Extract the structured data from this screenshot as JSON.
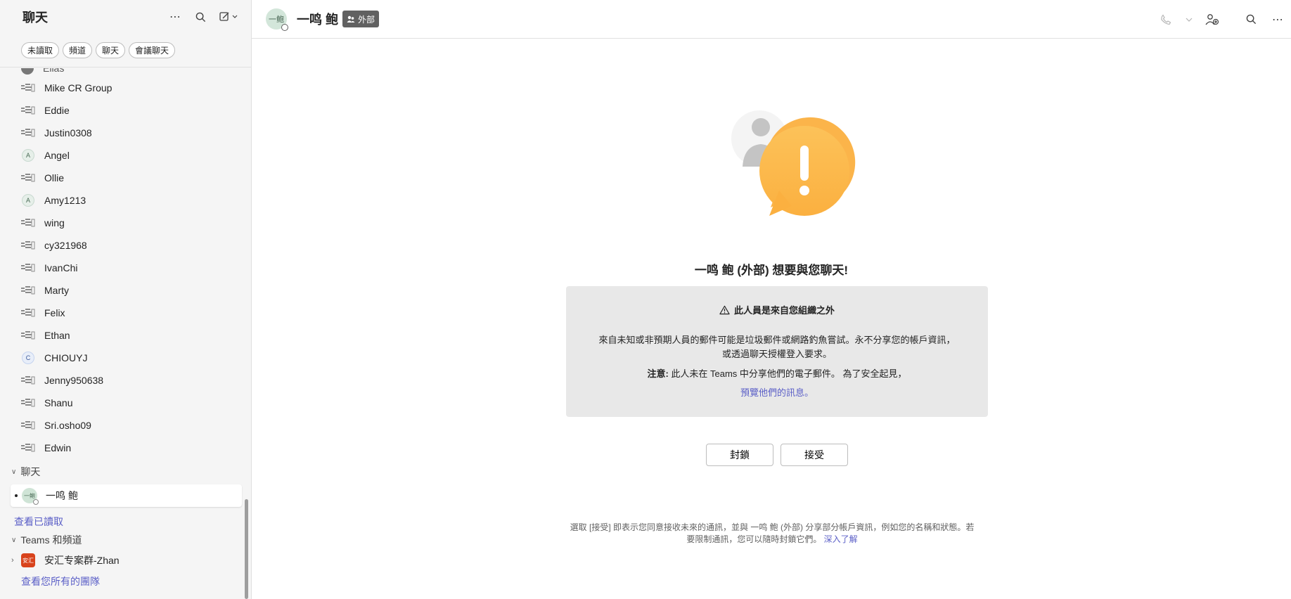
{
  "sidebar": {
    "title": "聊天",
    "filters": [
      "未讀取",
      "頻道",
      "聊天",
      "會議聊天"
    ],
    "partial_item": "Elias",
    "items": [
      {
        "label": "Mike CR Group",
        "avatar": "group"
      },
      {
        "label": "Eddie",
        "avatar": "group"
      },
      {
        "label": "Justin0308",
        "avatar": "group"
      },
      {
        "label": "Angel",
        "avatar": "A"
      },
      {
        "label": "Ollie",
        "avatar": "group"
      },
      {
        "label": "Amy1213",
        "avatar": "A"
      },
      {
        "label": "wing",
        "avatar": "group"
      },
      {
        "label": "cy321968",
        "avatar": "group"
      },
      {
        "label": "IvanChi",
        "avatar": "group"
      },
      {
        "label": "Marty",
        "avatar": "group"
      },
      {
        "label": "Felix",
        "avatar": "group"
      },
      {
        "label": "Ethan",
        "avatar": "group"
      },
      {
        "label": "CHIOUYJ",
        "avatar": "C"
      },
      {
        "label": "Jenny950638",
        "avatar": "group"
      },
      {
        "label": "Shanu",
        "avatar": "group"
      },
      {
        "label": "Sri.osho09",
        "avatar": "group"
      },
      {
        "label": "Edwin",
        "avatar": "group"
      }
    ],
    "chat_section": "聊天",
    "selected_chat": {
      "label": "一鸣 鲍",
      "avatar_text": "一鲍"
    },
    "view_read": "查看已讀取",
    "teams_section": "Teams 和頻道",
    "team": {
      "label": "安汇专案群-Zhan",
      "avatar_text": "安汇"
    },
    "view_all_teams": "查看您所有的團隊"
  },
  "header": {
    "name": "一鸣 鲍",
    "avatar_text": "一鲍",
    "badge": "外部"
  },
  "request": {
    "heading": "一鸣 鲍 (外部) 想要與您聊天!",
    "warn_title": "此人員是來自您組織之外",
    "warn_body_1": "來自未知或非預期人員的郵件可能是垃圾郵件或網路釣魚嘗試。永不分享您的帳戶資訊，",
    "warn_body_2": "或透過聊天授權登入要求。",
    "note_label": "注意:",
    "note_text": " 此人未在 Teams 中分享他們的電子郵件。 為了安全起見，",
    "preview_link": "預覽他們的訊息。",
    "block_label": "封鎖",
    "accept_label": "接受",
    "footer_line1": "選取 [接受] 即表示您同意接收未來的通訊，並與 一鸣 鲍 (外部) 分享部分帳戶資訊，例如您的名稱和狀態。若",
    "footer_line2": "要限制通訊，您可以隨時封鎖它們。",
    "footer_link": "深入了解"
  },
  "colors": {
    "accent": "#5b5fc7",
    "alert_orange": "#fbb040",
    "badge_bg": "#616161"
  }
}
